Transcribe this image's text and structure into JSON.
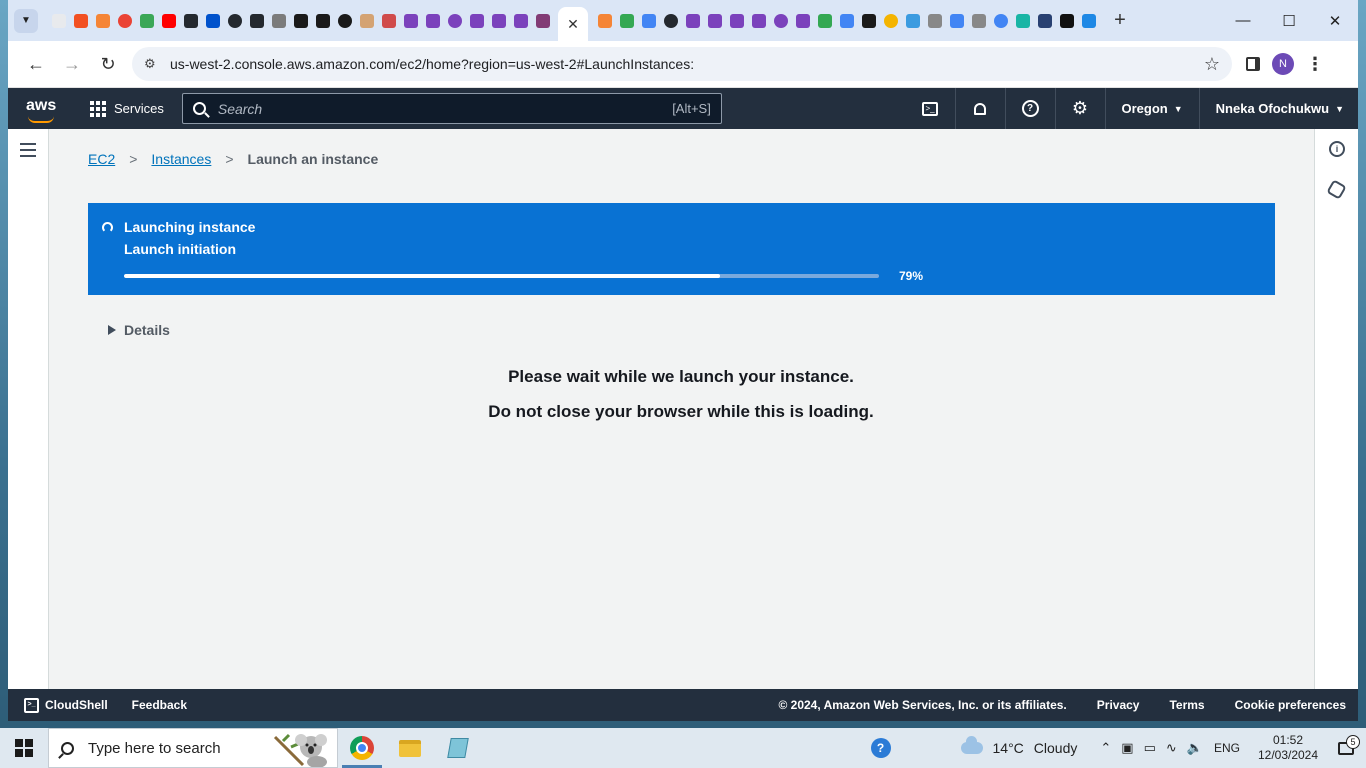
{
  "browser": {
    "tab_icon_colors": [
      "#e8eaed",
      "#f25022",
      "#f58536",
      "#ea4335",
      "#3aa757",
      "#ff0000",
      "#24292f",
      "#0052cc",
      "#24292f",
      "#24292f",
      "#7b7b7b",
      "#1a1a1a",
      "#1a1a1a",
      "#1a1a1a",
      "#d4a373",
      "#d04b4b",
      "#7b42bc",
      "#7b42bc",
      "#7b42bc",
      "#7b42bc",
      "#7b42bc",
      "#7b42bc",
      "#823b75"
    ],
    "tab_icon_colors_right": [
      "#f58536",
      "#34a853",
      "#4285f4",
      "#24292f",
      "#7b42bc",
      "#7b42bc",
      "#7b42bc",
      "#7b42bc",
      "#7b42bc",
      "#7b42bc",
      "#34a853",
      "#4285f4",
      "#1a1a1a",
      "#f4b400",
      "#3b9be0",
      "#888888",
      "#4285f4",
      "#888888",
      "#4285f4",
      "#19b5a5",
      "#294172",
      "#111111",
      "#1e88e5"
    ],
    "url": "us-west-2.console.aws.amazon.com/ec2/home?region=us-west-2#LaunchInstances:",
    "profile_initial": "N"
  },
  "aws_nav": {
    "logo": "aws",
    "services_label": "Services",
    "search_placeholder": "Search",
    "search_shortcut": "[Alt+S]",
    "region": "Oregon",
    "user": "Nneka Ofochukwu"
  },
  "breadcrumb": {
    "items": [
      "EC2",
      "Instances"
    ],
    "current": "Launch an instance"
  },
  "flash": {
    "title": "Launching instance",
    "subtitle": "Launch initiation",
    "progress": 0.79,
    "progress_label": "79%",
    "color": "#0972d3"
  },
  "details": {
    "label": "Details"
  },
  "message": {
    "line1": "Please wait while we launch your instance.",
    "line2": "Do not close your browser while this is loading."
  },
  "footer": {
    "cloudshell": "CloudShell",
    "feedback": "Feedback",
    "copyright": "© 2024, Amazon Web Services, Inc. or its affiliates.",
    "privacy": "Privacy",
    "terms": "Terms",
    "cookie": "Cookie preferences"
  },
  "taskbar": {
    "search_placeholder": "Type here to search",
    "weather_temp": "14°C",
    "weather_desc": "Cloudy",
    "language": "ENG",
    "time": "01:52",
    "date": "12/03/2024",
    "notifications": "5"
  }
}
